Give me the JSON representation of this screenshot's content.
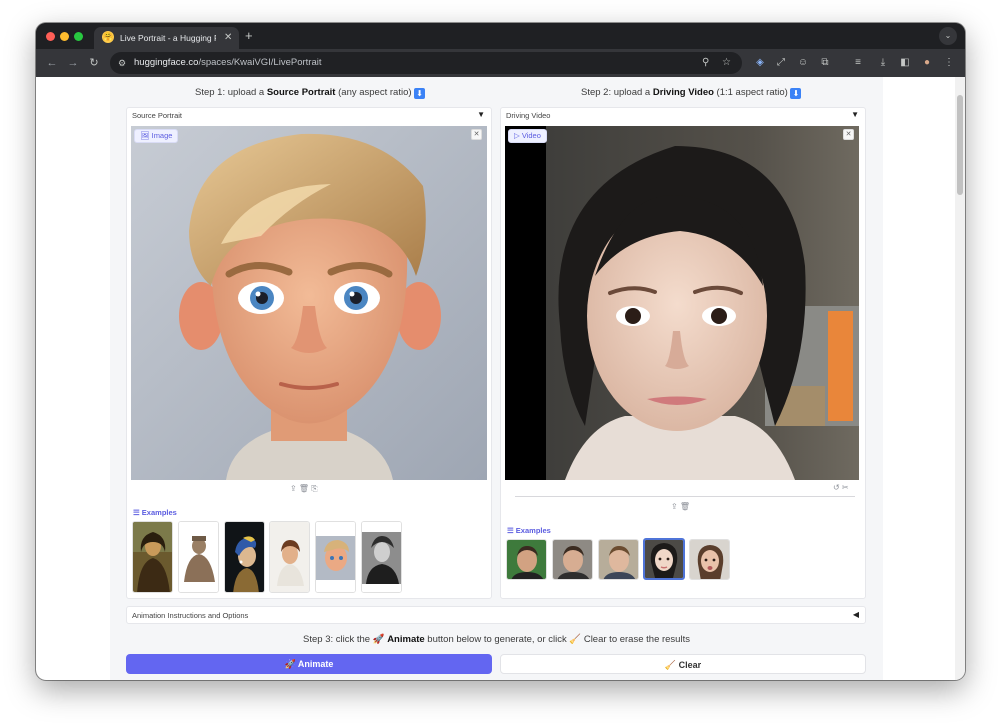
{
  "browser": {
    "tab_title": "Live Portrait - a Hugging Face",
    "tab_favicon": "🤗",
    "url_host": "huggingface.co",
    "url_path": "/spaces/KwaiVGI/LivePortrait",
    "tab_close": "✕",
    "new_tab": "+",
    "tab_search": "⌄",
    "back": "←",
    "forward": "→",
    "reload": "↻",
    "tune": "⚙",
    "zoom": "⚲",
    "bookmark": "☆",
    "ext1": "◈",
    "ext2": "⤢",
    "ext3": "☺",
    "ext4": "⧉",
    "media": "≡",
    "download": "⤓",
    "sidepanel": "◧",
    "profile": "●",
    "menu": "⋮"
  },
  "steps": {
    "step1_pre": "Step 1: upload a ",
    "step1_bold": "Source Portrait",
    "step1_post": " (any aspect ratio) ",
    "step1_icon": "⬇",
    "step2_pre": "Step 2: upload a ",
    "step2_bold": "Driving Video",
    "step2_post": " (1:1 aspect ratio) ",
    "step2_icon": "⬇",
    "step3_pre": "Step 3: click the 🚀 ",
    "step3_bold": "Animate",
    "step3_post": " button below to generate, or click 🧹 Clear to erase the results"
  },
  "source_panel": {
    "label": "Source Portrait",
    "caret": "▼",
    "badge": "🖼 Image",
    "close": "✕",
    "tools": "⇪  🗑  ⎘",
    "examples_label": "☰ Examples"
  },
  "driving_panel": {
    "label": "Driving Video",
    "caret": "▼",
    "badge": "▷ Video",
    "close": "✕",
    "trim_tools": "↺ ✂",
    "tools": "⇪  🗑",
    "examples_label": "☰ Examples"
  },
  "accordion": {
    "label": "Animation Instructions and Options",
    "caret": "◀"
  },
  "buttons": {
    "animate": "🚀 Animate",
    "clear": "🧹 Clear"
  },
  "colors": {
    "accent": "#6366f1",
    "badge_text": "#5b5ce0"
  }
}
